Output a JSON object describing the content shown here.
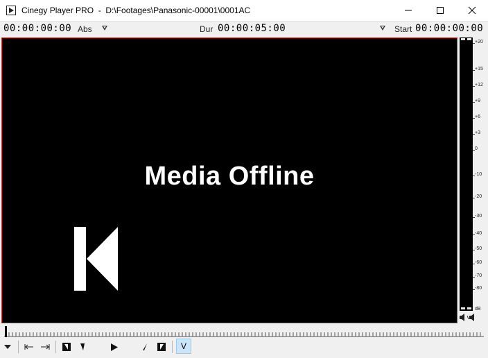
{
  "window": {
    "title": "Cinegy Player PRO  -  D:\\Footages\\Panasonic-00001\\0001AC",
    "minimize_icon": "minimize-icon",
    "maximize_icon": "maximize-icon",
    "close_icon": "close-icon"
  },
  "timecodes": {
    "current": "00:00:00:00",
    "current_mode": "Abs",
    "duration_label": "Dur",
    "duration": "00:00:05:00",
    "start_label": "Start",
    "start": "00:00:00:00"
  },
  "video": {
    "status_text": "Media Offline",
    "overlay_icon": "skip-to-start-icon",
    "border_color": "#c8302c"
  },
  "audio_meter": {
    "scale": [
      "+20",
      "+15",
      "+12",
      "+9",
      "+6",
      "+3",
      "0",
      "-10",
      "-20",
      "-30",
      "-40",
      "-50",
      "-60",
      "-70",
      "-80",
      "dB"
    ],
    "channels": 2,
    "mute_icons": [
      "speaker-left-icon",
      "speaker-right-icon"
    ]
  },
  "transport": {
    "buttons": [
      "menu-dropdown-icon",
      "mark-in-icon",
      "mark-out-icon",
      "go-to-in-icon",
      "step-back-icon",
      "play-icon",
      "step-forward-icon",
      "go-to-out-icon"
    ],
    "v_label": "V",
    "position": 0
  }
}
